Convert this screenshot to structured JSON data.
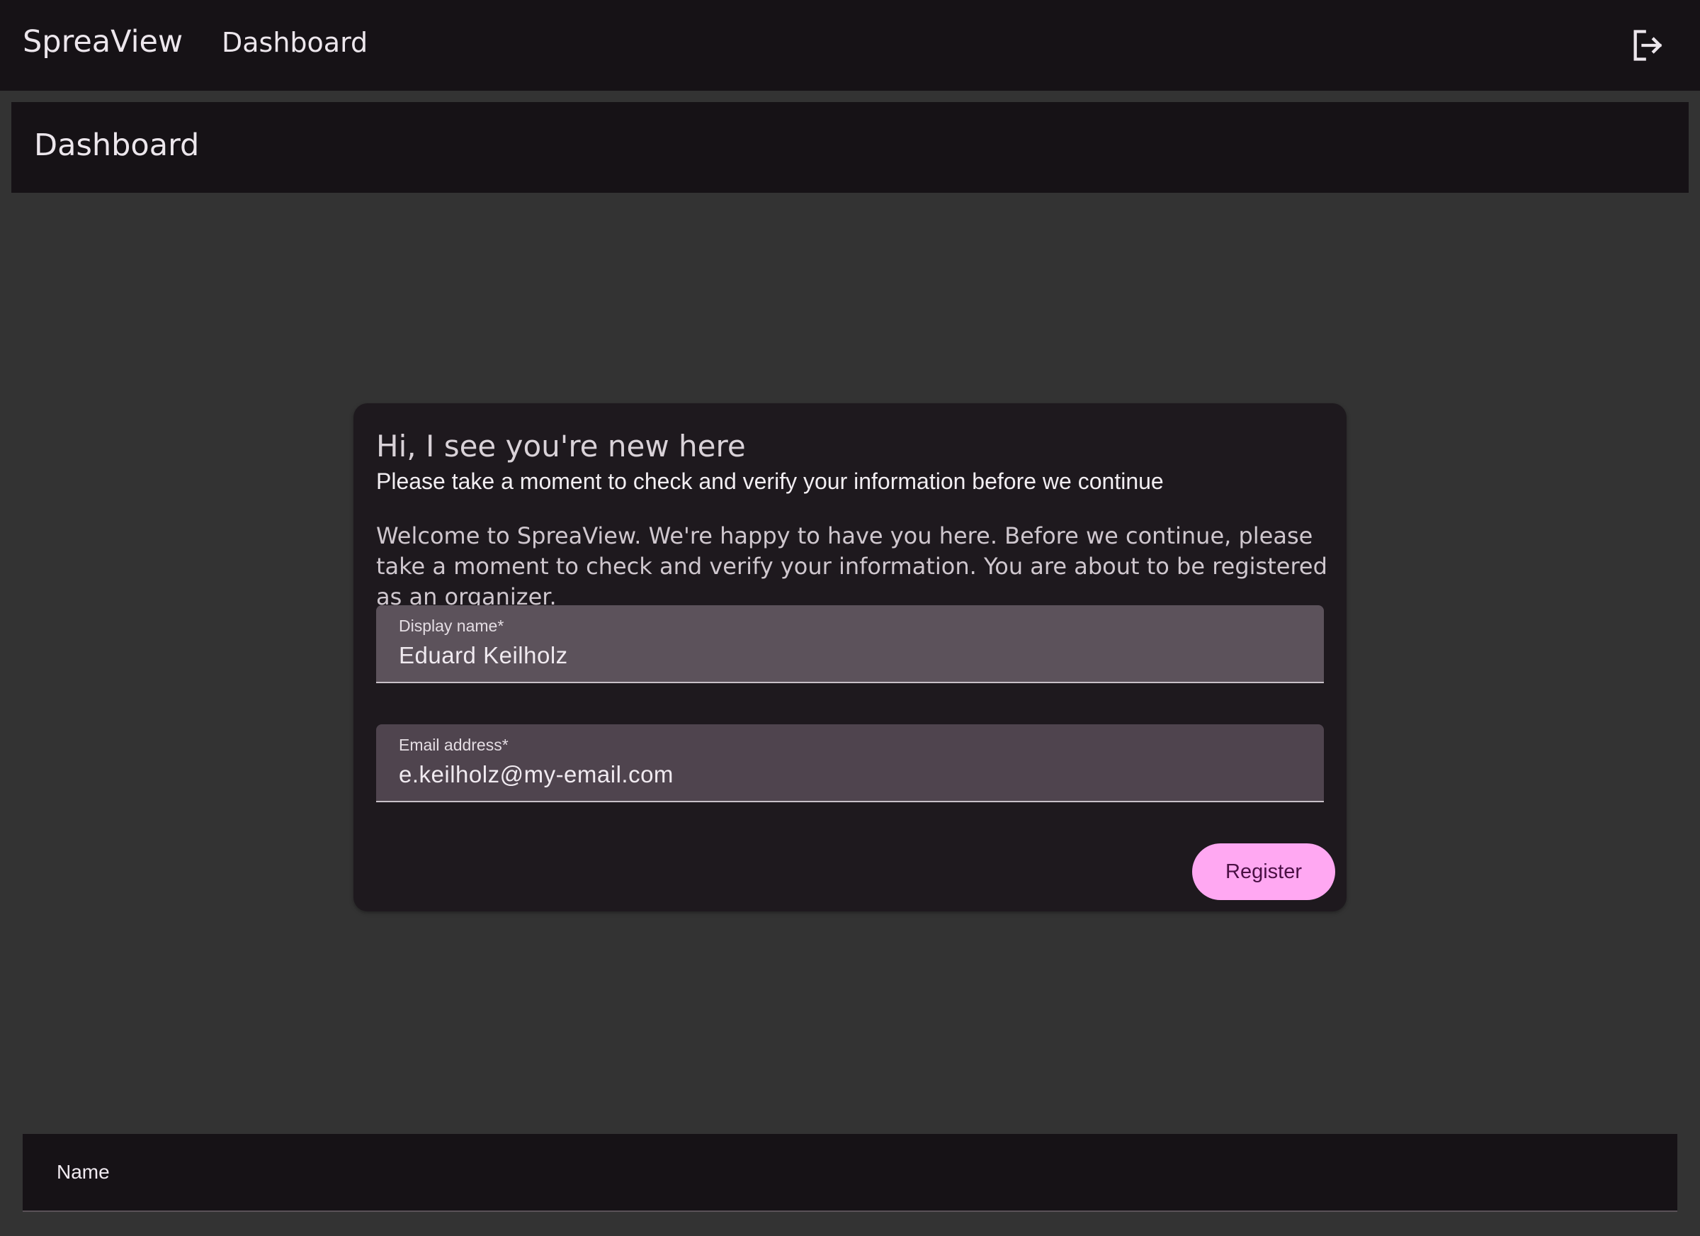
{
  "topbar": {
    "brand": "SpreaView",
    "nav_link": "Dashboard",
    "logout_icon": "logout-icon"
  },
  "page": {
    "title": "Dashboard"
  },
  "card": {
    "title": "Hi, I see you're new here",
    "subtitle": "Please take a moment to check and verify your information before we continue",
    "body": "Welcome to SpreaView. We're happy to have you here. Before we continue, please take a moment to check and verify your information. You are about to be registered as an organizer.",
    "display_name": {
      "label": "Display name*",
      "value": "Eduard Keilholz"
    },
    "email": {
      "label": "Email address*",
      "value": "e.keilholz@my-email.com"
    },
    "register_label": "Register",
    "colors": {
      "button_bg": "#ffa8f2",
      "button_text": "#4a1044"
    }
  },
  "table": {
    "columns": [
      "Name"
    ]
  }
}
